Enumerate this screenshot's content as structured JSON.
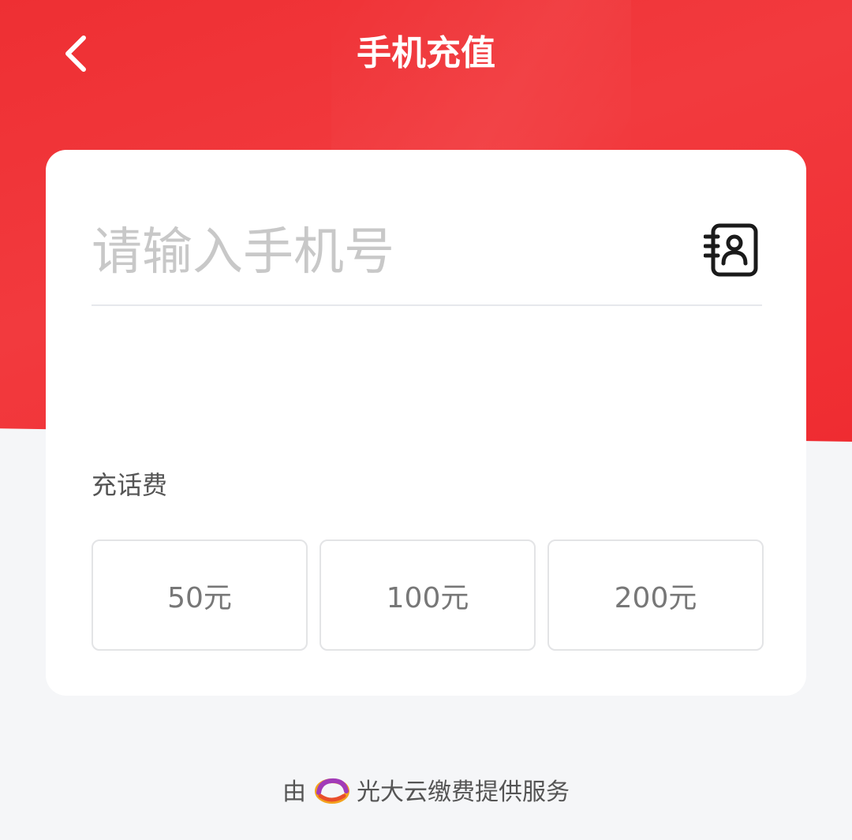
{
  "header": {
    "title": "手机充值"
  },
  "phone": {
    "value": "",
    "placeholder": "请输入手机号"
  },
  "recharge": {
    "section_label": "充话费",
    "amounts": [
      "50元",
      "100元",
      "200元"
    ]
  },
  "footer": {
    "prefix": "由",
    "provider": "光大云缴费提供服务"
  },
  "colors": {
    "header_red": "#ef2f33",
    "background": "#f5f6f8",
    "card": "#ffffff"
  },
  "icons": {
    "back": "chevron-left-icon",
    "contacts": "contacts-book-icon",
    "provider_logo": "everbright-cloud-logo-icon"
  }
}
